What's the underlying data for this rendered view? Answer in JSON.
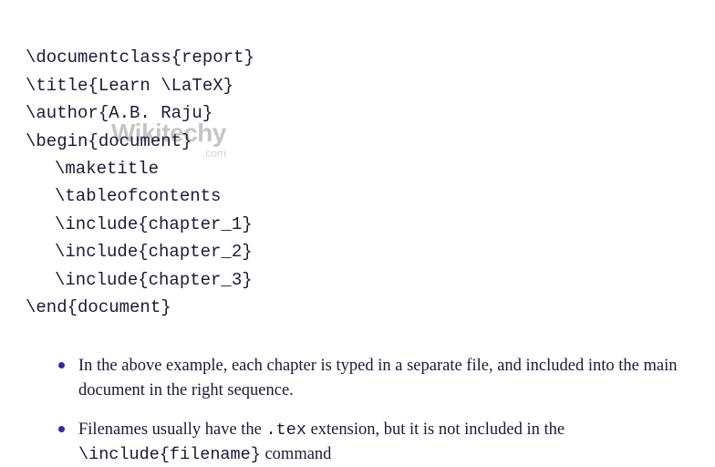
{
  "code": {
    "line1": "\\documentclass{report}",
    "line2": "\\title{Learn \\LaTeX}",
    "line3": "\\author{A.B. Raju}",
    "line4": "\\begin{document}",
    "line5": "\\maketitle",
    "line6": "\\tableofcontents",
    "line7": "\\include{chapter_1}",
    "line8": "\\include{chapter_2}",
    "line9": "\\include{chapter_3}",
    "line10": "\\end{document}"
  },
  "watermark": {
    "main": "Wikitechy",
    "sub": ".com"
  },
  "bullets": {
    "b1_part1": "In the above example, each chapter is typed in a separate file, and included into the main document in the right sequence.",
    "b2_part1": "Filenames usually have the ",
    "b2_tt1": ".tex",
    "b2_part2": " extension, but it is not included in the ",
    "b2_tt2": "\\include{filename}",
    "b2_part3": " command"
  }
}
